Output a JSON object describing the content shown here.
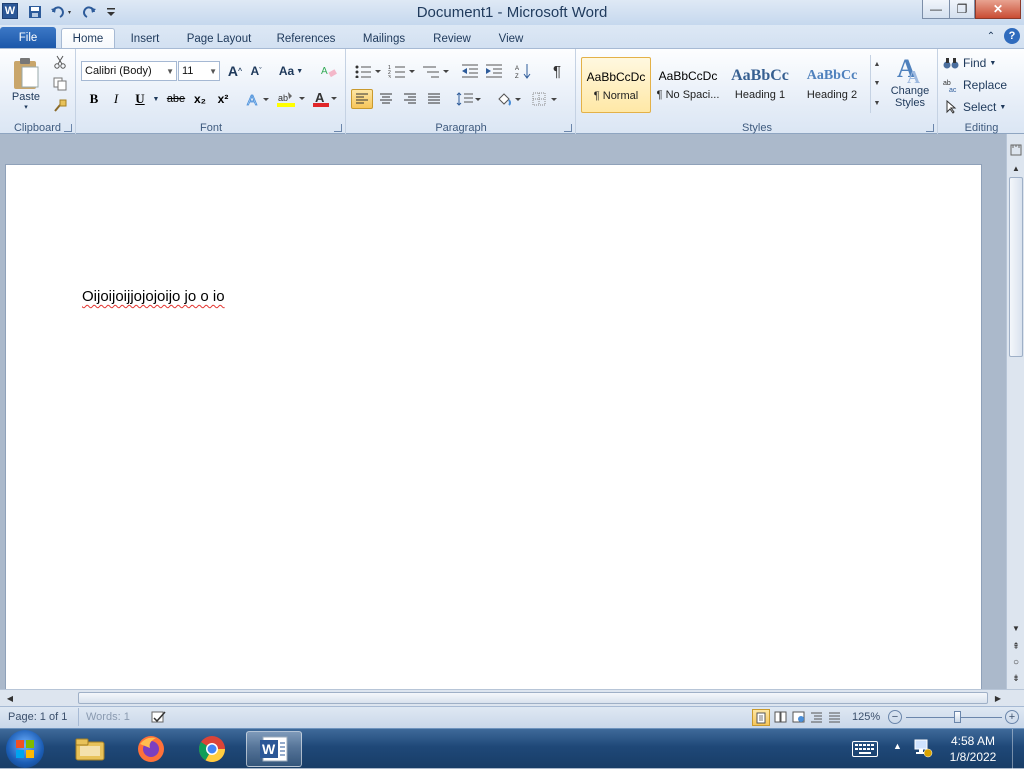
{
  "window": {
    "title": "Document1  -  Microsoft Word",
    "app_icon": "word-icon",
    "controls": {
      "minimize": "—",
      "restore": "❐",
      "close": "✕"
    }
  },
  "quick_access": {
    "save_icon": "save-icon",
    "undo_icon": "undo-icon",
    "redo_icon": "redo-icon",
    "customize_icon": "chevron-down-icon"
  },
  "tabs": [
    {
      "label": "File"
    },
    {
      "label": "Home"
    },
    {
      "label": "Insert"
    },
    {
      "label": "Page Layout"
    },
    {
      "label": "References"
    },
    {
      "label": "Mailings"
    },
    {
      "label": "Review"
    },
    {
      "label": "View"
    }
  ],
  "ribbon": {
    "clipboard": {
      "label": "Clipboard",
      "paste": "Paste"
    },
    "font": {
      "label": "Font",
      "font_name": "Calibri (Body)",
      "font_size": "11",
      "bold": "B",
      "italic": "I",
      "underline": "U",
      "strike": "abe",
      "subscript": "x₂",
      "superscript": "x²",
      "grow": "A",
      "shrink": "A",
      "case": "Aa"
    },
    "paragraph": {
      "label": "Paragraph",
      "pilcrow": "¶"
    },
    "styles": {
      "label": "Styles",
      "items": [
        {
          "preview": "AaBbCcDc",
          "name": "¶ Normal"
        },
        {
          "preview": "AaBbCcDc",
          "name": "¶ No Spaci..."
        },
        {
          "preview": "AaBbCc",
          "name": "Heading 1"
        },
        {
          "preview": "AaBbCc",
          "name": "Heading 2"
        }
      ],
      "change_styles": "Change Styles"
    },
    "editing": {
      "label": "Editing",
      "find": "Find",
      "replace": "Replace",
      "select": "Select"
    }
  },
  "document": {
    "text": "Oijoijoijjojojoijo  jo o io"
  },
  "status": {
    "page": "Page: 1 of 1",
    "words": "Words: 1",
    "zoom": "125%"
  },
  "taskbar": {
    "time": "4:58 AM",
    "date": "1/8/2022"
  }
}
